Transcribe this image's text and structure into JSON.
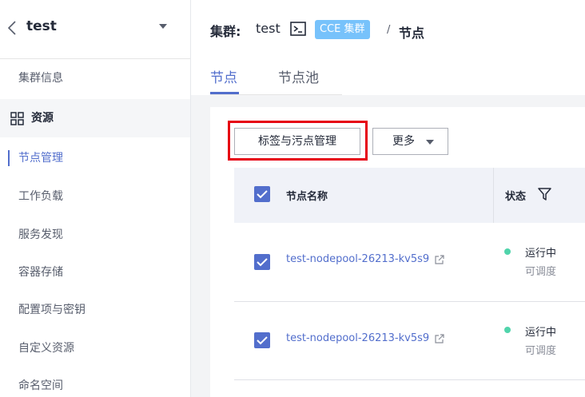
{
  "sidebar": {
    "title": "test",
    "items": [
      {
        "label": "集群信息"
      },
      {
        "label": "资源"
      },
      {
        "label": "节点管理"
      },
      {
        "label": "工作负载"
      },
      {
        "label": "服务发现"
      },
      {
        "label": "容器存储"
      },
      {
        "label": "配置项与密钥"
      },
      {
        "label": "自定义资源"
      },
      {
        "label": "命名空间"
      }
    ]
  },
  "header": {
    "cluster_label": "集群:",
    "cluster_name": "test",
    "badge": "CCE 集群",
    "separator": "/",
    "current": "节点"
  },
  "tabs": [
    {
      "label": "节点"
    },
    {
      "label": "节点池"
    }
  ],
  "toolbar": {
    "tags_button": "标签与污点管理",
    "more_button": "更多"
  },
  "table": {
    "columns": [
      "节点名称",
      "状态"
    ],
    "rows": [
      {
        "name": "test-nodepool-26213-kv5s9",
        "status": "运行中",
        "sub_status": "可调度"
      },
      {
        "name": "test-nodepool-26213-kv5s9",
        "status": "运行中",
        "sub_status": "可调度"
      }
    ]
  },
  "colors": {
    "accent": "#526ecc",
    "badge": "#77c2fb",
    "highlight": "#e60012",
    "status_running": "#50d4ab"
  }
}
